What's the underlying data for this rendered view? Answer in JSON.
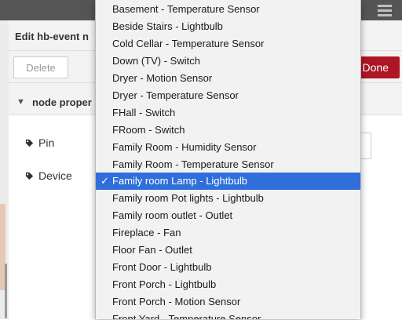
{
  "header": {
    "menu_icon": "hamburger-icon"
  },
  "tray": {
    "title": "Edit hb-event n",
    "delete_label": "Delete",
    "done_label": "Done",
    "section_label": "node proper",
    "fields": [
      {
        "label": "Pin",
        "icon": "tag-icon"
      },
      {
        "label": "Device",
        "icon": "tag-icon"
      }
    ]
  },
  "dropdown": {
    "selected_index": 9,
    "check_glyph": "✓",
    "options": [
      "Basement - Temperature Sensor",
      "Beside Stairs - Lightbulb",
      "Cold Cellar - Temperature Sensor",
      "Down (TV) - Switch",
      "Dryer - Motion Sensor",
      "Dryer - Temperature Sensor",
      "FHall - Switch",
      "FRoom - Switch",
      "Family Room - Humidity Sensor",
      "Family Room - Temperature Sensor",
      "Family room Lamp - Lightbulb",
      "Family room Pot lights - Lightbulb",
      "Family room outlet - Outlet",
      "Fireplace - Fan",
      "Floor Fan - Outlet",
      "Front Door - Lightbulb",
      "Front Porch - Lightbulb",
      "Front Porch - Motion Sensor",
      "Front Yard - Temperature Sensor"
    ]
  },
  "colors": {
    "selected_bg": "#2f6edb",
    "done_bg": "#ad1625",
    "topbar_bg": "#555555"
  }
}
